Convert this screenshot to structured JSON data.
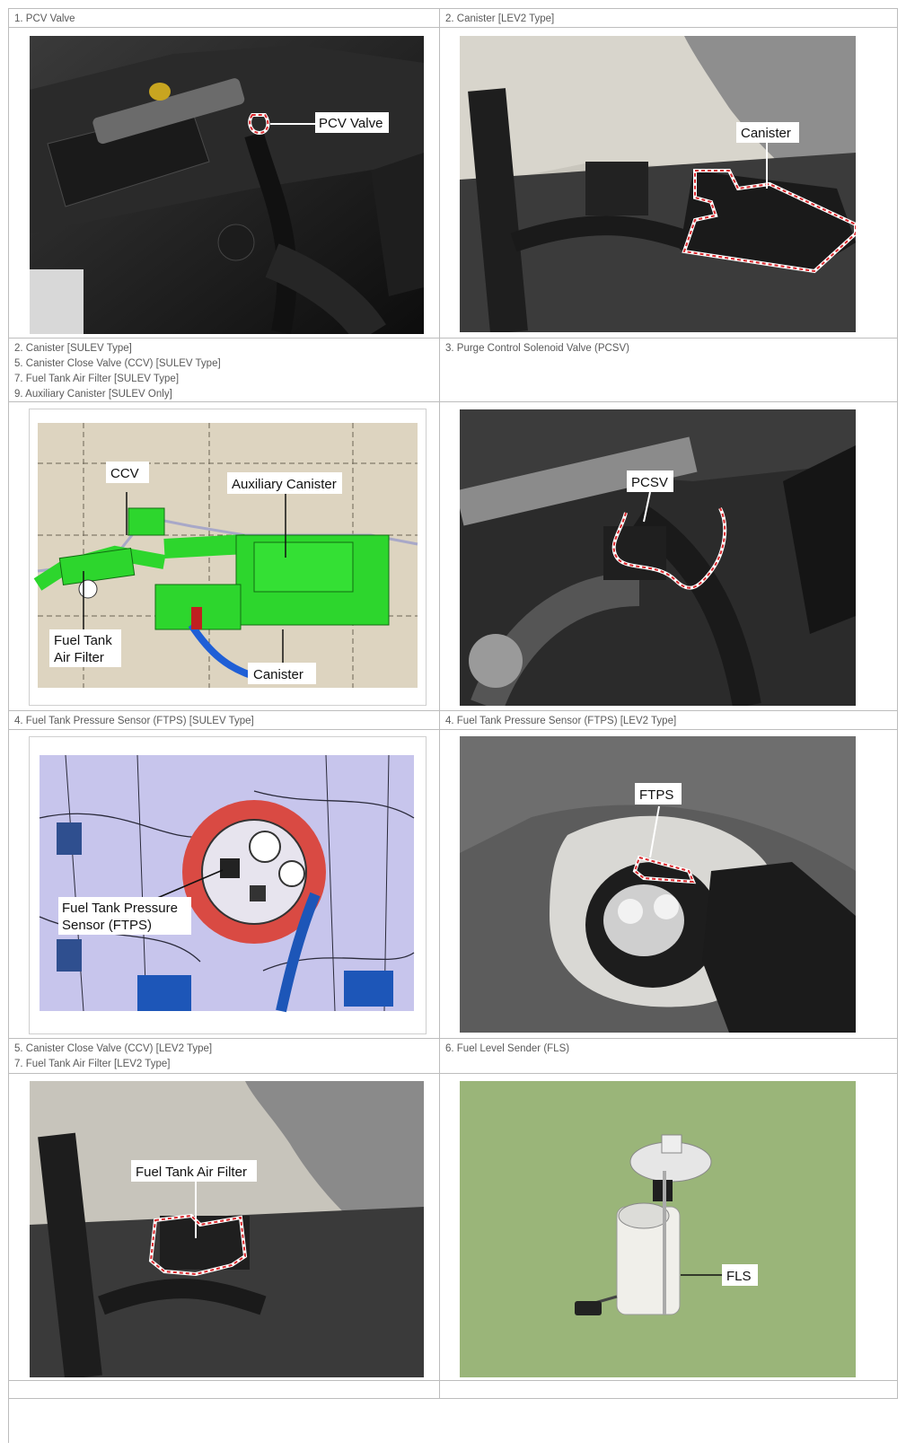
{
  "rows": [
    {
      "left_caption": [
        "1. PCV Valve"
      ],
      "right_caption": [
        "2. Canister [LEV2 Type]"
      ]
    },
    {
      "left_caption": [
        "2. Canister [SULEV Type]",
        "5. Canister Close Valve (CCV) [SULEV Type]",
        "7. Fuel Tank Air Filter [SULEV Type]",
        "9. Auxiliary Canister [SULEV Only]"
      ],
      "right_caption": [
        "3. Purge Control Solenoid Valve (PCSV)"
      ]
    },
    {
      "left_caption": [
        "4. Fuel Tank Pressure Sensor (FTPS) [SULEV Type]"
      ],
      "right_caption": [
        "4. Fuel Tank Pressure Sensor (FTPS) [LEV2 Type]"
      ]
    },
    {
      "left_caption": [
        "5. Canister Close Valve (CCV) [LEV2 Type]",
        "7. Fuel Tank Air Filter [LEV2 Type]"
      ],
      "right_caption": [
        "6. Fuel Level Sender (FLS)"
      ]
    }
  ],
  "figures": {
    "pcv": {
      "label": "PCV Valve"
    },
    "canister_lev2": {
      "label": "Canister"
    },
    "sulev_diagram": {
      "ccv": "CCV",
      "aux": "Auxiliary Canister",
      "filter_line1": "Fuel Tank",
      "filter_line2": "Air Filter",
      "canister": "Canister"
    },
    "pcsv": {
      "label": "PCSV"
    },
    "ftps_diagram": {
      "line1": "Fuel Tank Pressure",
      "line2": "Sensor (FTPS)"
    },
    "ftps_photo": {
      "label": "FTPS"
    },
    "air_filter": {
      "label": "Fuel Tank Air Filter"
    },
    "fls": {
      "label": "FLS"
    }
  },
  "colors": {
    "highlight": "#d8262b",
    "diagram_green": "#2dd62d",
    "fls_background": "#9ab579",
    "grid_line": "#bdbdbd"
  }
}
